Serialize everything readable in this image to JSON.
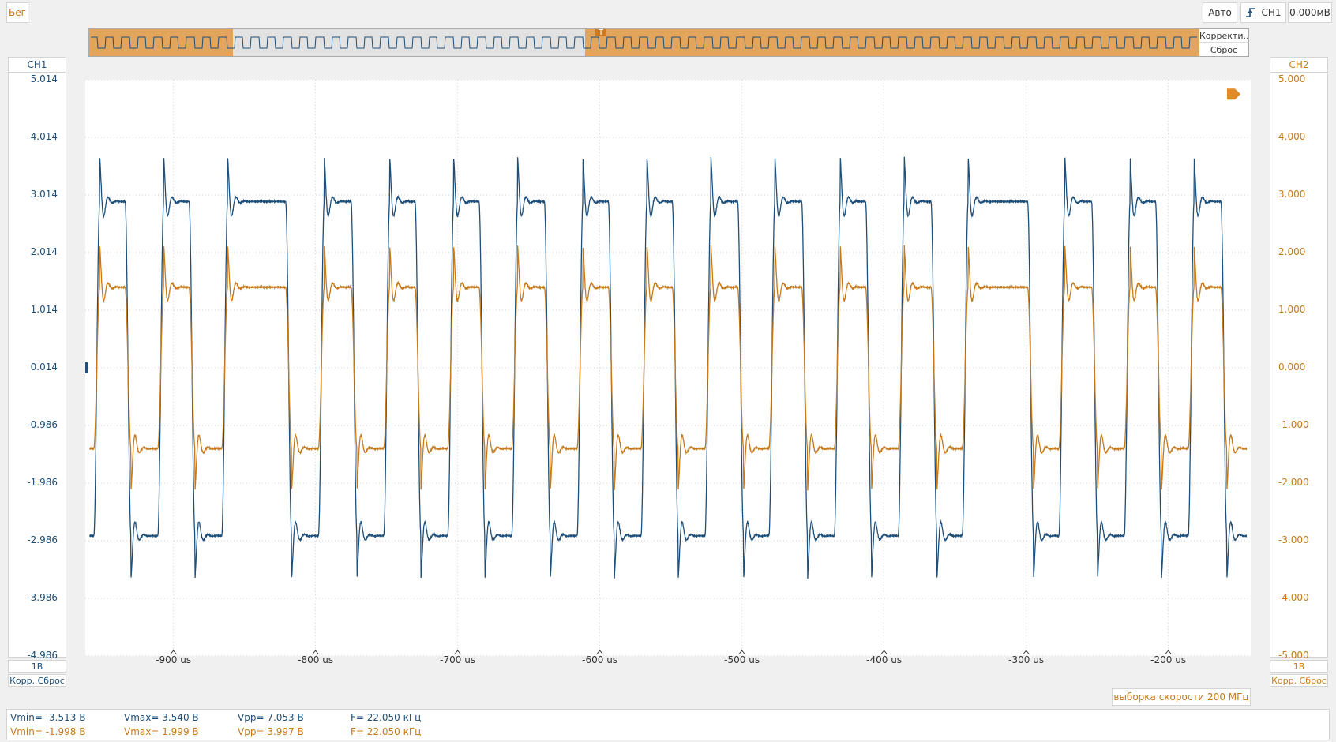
{
  "toolbar": {
    "run_label": "Бег",
    "auto_label": "Авто",
    "trigger_source": "CH1",
    "trigger_level": "0.000мВ"
  },
  "overview": {
    "correct_label": "Корректи...",
    "reset_label": "Сброс",
    "trigger_marker": "T"
  },
  "channels": {
    "ch1": {
      "label": "CH1",
      "scale": "1В",
      "corr_reset": "Корр. Сброс",
      "color": "#1d4f7a"
    },
    "ch2": {
      "label": "CH2",
      "scale": "1В",
      "corr_reset": "Корр. Сброс",
      "color": "#c77a1a"
    }
  },
  "sample_rate": "выборка скорости 200 МГц",
  "measurements": {
    "ch1": {
      "vmin": "Vmin= -3.513 В",
      "vmax": "Vmax= 3.540 В",
      "vpp": "Vpp= 7.053 В",
      "freq": "F= 22.050 кГц"
    },
    "ch2": {
      "vmin": "Vmin= -1.998 В",
      "vmax": "Vmax= 1.999 В",
      "vpp": "Vpp= 3.997 В",
      "freq": "F= 22.050 кГц"
    }
  },
  "chart_data": {
    "type": "line",
    "title": "",
    "xlabel": "",
    "ylabel": "",
    "x_unit": "us",
    "xlim": [
      -962,
      -142
    ],
    "x_tick_values": [
      -900,
      -800,
      -700,
      -600,
      -500,
      -400,
      -300,
      -200
    ],
    "x_tick_labels": [
      "-900 us",
      "-800 us",
      "-700 us",
      "-600 us",
      "-500 us",
      "-400 us",
      "-300 us",
      "-200 us"
    ],
    "y_left": {
      "lim": [
        -4.986,
        5.014
      ],
      "tick_labels": [
        "5.014",
        "4.014",
        "3.014",
        "2.014",
        "1.014",
        "0.014",
        "-0.986",
        "-1.986",
        "-2.986",
        "-3.986",
        "-4.986"
      ]
    },
    "y_right": {
      "lim": [
        -5.0,
        5.0
      ],
      "tick_labels": [
        "5.000",
        "4.000",
        "3.000",
        "2.000",
        "1.000",
        "0.000",
        "-1.000",
        "-2.000",
        "-3.000",
        "-4.000",
        "-5.000"
      ]
    },
    "grid": true,
    "period_us": 45.35,
    "series": [
      {
        "id": "ch1",
        "color": "#1d4f7a",
        "high_level": 2.9,
        "low_level": -2.9,
        "peak_max": 3.54,
        "peak_min": -3.513,
        "rising_edges_us": [
          -956,
          -911,
          -866,
          -798,
          -752,
          -707,
          -662,
          -616,
          -571,
          -526,
          -481,
          -435,
          -390,
          -345,
          -277,
          -231,
          -186,
          -141
        ],
        "falling_edges_us": [
          -934,
          -889,
          -821,
          -775,
          -730,
          -685,
          -639,
          -594,
          -549,
          -503,
          -458,
          -413,
          -367,
          -299,
          -254,
          -209,
          -163
        ]
      },
      {
        "id": "ch2",
        "color": "#c77a1a",
        "high_level": 1.4,
        "low_level": -1.4,
        "peak_max": 1.999,
        "peak_min": -1.998,
        "rising_edges_us": [
          -956,
          -911,
          -866,
          -798,
          -752,
          -707,
          -662,
          -616,
          -571,
          -526,
          -481,
          -435,
          -390,
          -345,
          -277,
          -231,
          -186,
          -141
        ],
        "falling_edges_us": [
          -934,
          -889,
          -821,
          -775,
          -730,
          -685,
          -639,
          -594,
          -549,
          -503,
          -458,
          -413,
          -367,
          -299,
          -254,
          -209,
          -163
        ]
      }
    ]
  }
}
